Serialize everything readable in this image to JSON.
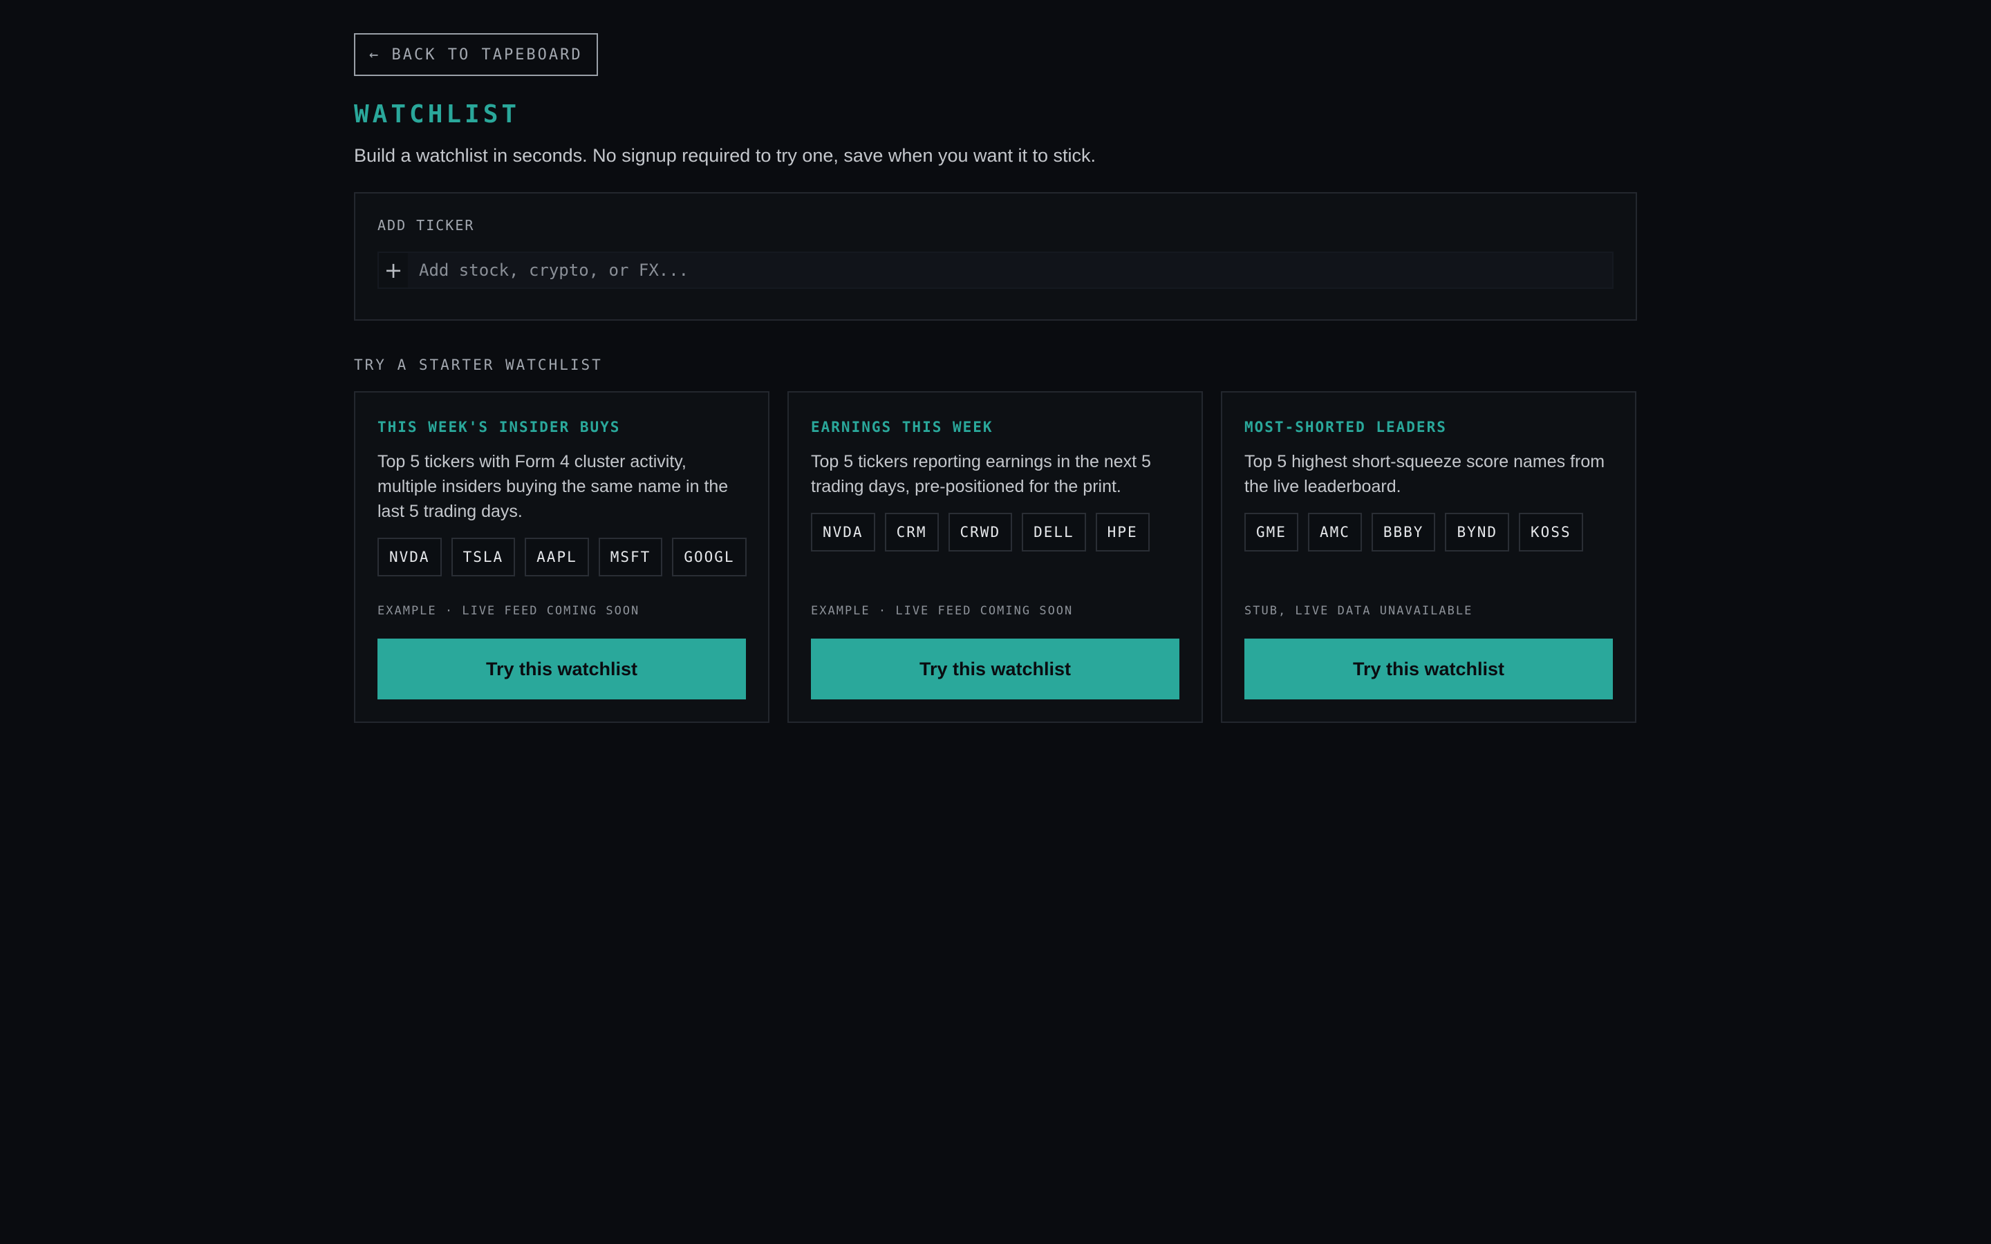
{
  "nav": {
    "back_label": "← BACK TO TAPEBOARD"
  },
  "page": {
    "title": "WATCHLIST",
    "subtitle": "Build a watchlist in seconds. No signup required to try one, save when you want it to stick."
  },
  "add_ticker": {
    "label": "ADD TICKER",
    "plus_icon": "+",
    "placeholder": "Add stock, crypto, or FX..."
  },
  "starters": {
    "section_label": "TRY A STARTER WATCHLIST",
    "cards": [
      {
        "title": "THIS WEEK'S INSIDER BUYS",
        "description": "Top 5 tickers with Form 4 cluster activity, multiple insiders buying the same name in the last 5 trading days.",
        "tickers": [
          "NVDA",
          "TSLA",
          "AAPL",
          "MSFT",
          "GOOGL"
        ],
        "note": "EXAMPLE · LIVE FEED COMING SOON",
        "button": "Try this watchlist"
      },
      {
        "title": "EARNINGS THIS WEEK",
        "description": "Top 5 tickers reporting earnings in the next 5 trading days, pre-positioned for the print.",
        "tickers": [
          "NVDA",
          "CRM",
          "CRWD",
          "DELL",
          "HPE"
        ],
        "note": "EXAMPLE · LIVE FEED COMING SOON",
        "button": "Try this watchlist"
      },
      {
        "title": "MOST-SHORTED LEADERS",
        "description": "Top 5 highest short-squeeze score names from the live leaderboard.",
        "tickers": [
          "GME",
          "AMC",
          "BBBY",
          "BYND",
          "KOSS"
        ],
        "note": "STUB, LIVE DATA UNAVAILABLE",
        "button": "Try this watchlist"
      }
    ]
  },
  "colors": {
    "background": "#0a0c10",
    "accent": "#2aa89b",
    "panel": "#0d1014",
    "border": "#23272e"
  }
}
